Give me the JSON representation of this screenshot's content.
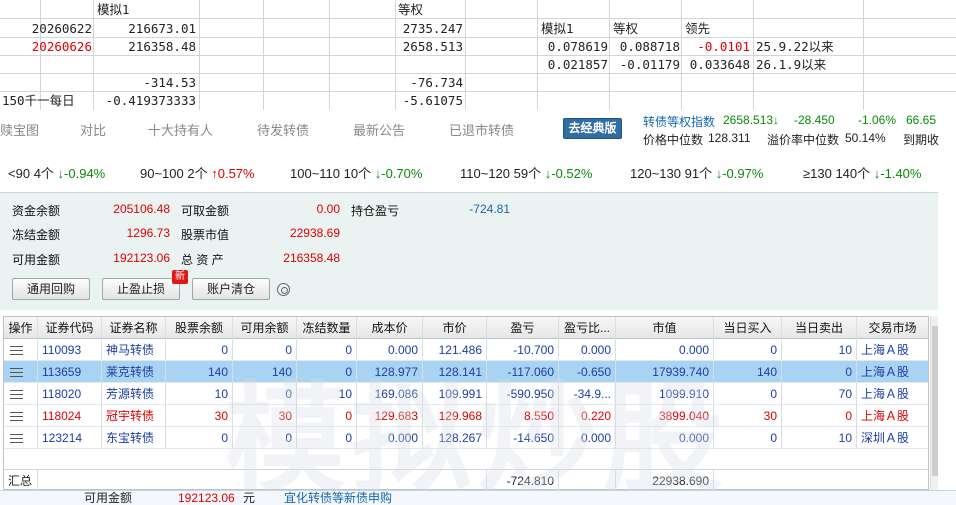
{
  "sheet": {
    "header_sim": "模拟1",
    "header_equal": "等权",
    "row1": {
      "date": "20260622",
      "sim": "216673.01",
      "equal": "2735.247"
    },
    "row2": {
      "date": "20260626",
      "sim": "216358.48",
      "equal": "2658.513"
    },
    "row4": {
      "sim": "-314.53",
      "equal": "-76.734"
    },
    "row5": {
      "label": "150千一每日",
      "sim": "-0.419373333",
      "equal": "-5.61075"
    },
    "side": {
      "h_sim": "模拟1",
      "h_equal": "等权",
      "h_lead": "领先",
      "r1": {
        "sim": "0.078619",
        "equal": "0.088718",
        "lead": "-0.0101",
        "since": "25.9.22以来"
      },
      "r2": {
        "sim": "0.021857",
        "equal": "-0.01179",
        "lead": "0.033648",
        "since": "26.1.9以来"
      }
    }
  },
  "tabs": [
    "赎宝图",
    "对比",
    "十大持有人",
    "待发转债",
    "最新公告",
    "已退市转债"
  ],
  "classic_button": "去经典版",
  "index": {
    "name": "转债等权指数",
    "value": "2658.513↓",
    "change": "-28.450",
    "pct": "-1.06%",
    "extra": "66.65",
    "median_label": "价格中位数",
    "median": "128.311",
    "premium_label": "溢价率中位数",
    "premium": "50.14%",
    "expiry_label": "到期收"
  },
  "distribution": [
    {
      "range": "<90",
      "count": "4个",
      "pct": "↓-0.94%",
      "dir": "down"
    },
    {
      "range": "90~100",
      "count": "2个",
      "pct": "↑0.57%",
      "dir": "up"
    },
    {
      "range": "100~110",
      "count": "10个",
      "pct": "↓-0.70%",
      "dir": "down"
    },
    {
      "range": "110~120",
      "count": "59个",
      "pct": "↓-0.52%",
      "dir": "down"
    },
    {
      "range": "120~130",
      "count": "91个",
      "pct": "↓-0.97%",
      "dir": "down"
    },
    {
      "range": "≥130",
      "count": "140个",
      "pct": "↓-1.40%",
      "dir": "down"
    }
  ],
  "account": {
    "funds_label": "资金余额",
    "funds": "205106.48",
    "withdrawable_label": "可取金额",
    "withdrawable": "0.00",
    "position_pl_label": "持仓盈亏",
    "position_pl": "-724.81",
    "frozen_label": "冻结金额",
    "frozen": "1296.73",
    "stock_value_label": "股票市值",
    "stock_value": "22938.69",
    "available_label": "可用金额",
    "available": "192123.06",
    "total_assets_label": "总 资 产",
    "total_assets": "216358.48",
    "btn_repo": "通用回购",
    "btn_stop": "止盈止损",
    "btn_clear": "账户清仓",
    "new_badge": "新"
  },
  "watermark": "模拟炒股",
  "table": {
    "headers": [
      "操作",
      "证券代码",
      "证券名称",
      "股票余额",
      "可用余额",
      "冻结数量",
      "成本价",
      "市价",
      "盈亏",
      "盈亏比...",
      "市值",
      "当日买入",
      "当日卖出",
      "交易市场"
    ],
    "rows": [
      {
        "code": "110093",
        "name": "神马转债",
        "bal": "0",
        "avail": "0",
        "frozen": "0",
        "cost": "0.000",
        "price": "121.486",
        "pl": "-10.700",
        "plr": "0.000",
        "mv": "0.000",
        "buy": "0",
        "sell": "10",
        "market": "上海Ａ股",
        "tone": "blue",
        "selected": false
      },
      {
        "code": "113659",
        "name": "莱克转债",
        "bal": "140",
        "avail": "140",
        "frozen": "0",
        "cost": "128.977",
        "price": "128.141",
        "pl": "-117.060",
        "plr": "-0.650",
        "mv": "17939.740",
        "buy": "140",
        "sell": "0",
        "market": "上海Ａ股",
        "tone": "blue",
        "selected": true
      },
      {
        "code": "118020",
        "name": "芳源转债",
        "bal": "10",
        "avail": "0",
        "frozen": "10",
        "cost": "169.086",
        "price": "109.991",
        "pl": "-590.950",
        "plr": "-34.9...",
        "mv": "1099.910",
        "buy": "0",
        "sell": "70",
        "market": "上海Ａ股",
        "tone": "blue",
        "selected": false
      },
      {
        "code": "118024",
        "name": "冠宇转债",
        "bal": "30",
        "avail": "30",
        "frozen": "0",
        "cost": "129.683",
        "price": "129.968",
        "pl": "8.550",
        "plr": "0.220",
        "mv": "3899.040",
        "buy": "30",
        "sell": "0",
        "market": "上海Ａ股",
        "tone": "red",
        "selected": false
      },
      {
        "code": "123214",
        "name": "东宝转债",
        "bal": "0",
        "avail": "0",
        "frozen": "0",
        "cost": "0.000",
        "price": "128.267",
        "pl": "-14.650",
        "plr": "0.000",
        "mv": "0.000",
        "buy": "0",
        "sell": "10",
        "market": "深圳Ａ股",
        "tone": "blue",
        "selected": false
      }
    ],
    "summary": {
      "label": "汇总",
      "pl": "-724.810",
      "mv": "22938.690"
    }
  },
  "status": {
    "available_label": "可用金额",
    "available": "192123.06",
    "unit": "元",
    "link": "宜化转债等新债申购"
  },
  "colors": {
    "up": "#e00000",
    "down": "#0a8a0a",
    "accent": "#2f6da3",
    "selected_row": "#a8d3f2"
  }
}
